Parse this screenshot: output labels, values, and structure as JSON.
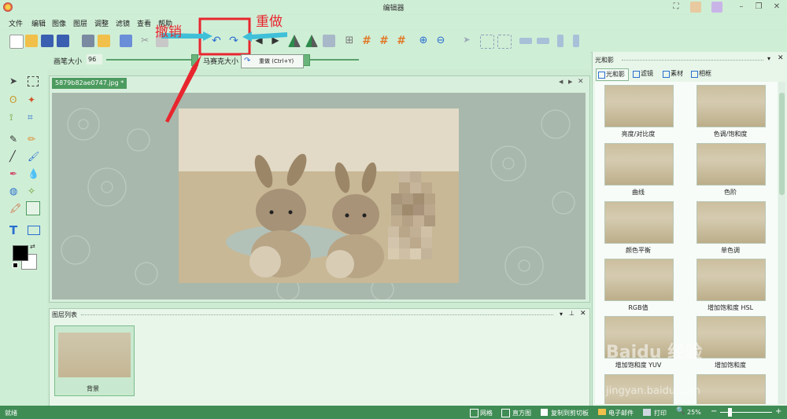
{
  "window": {
    "title": "编辑器"
  },
  "menu": {
    "items": [
      "文件",
      "编辑",
      "图像",
      "图层",
      "调整",
      "滤镜",
      "查看",
      "帮助"
    ]
  },
  "brush": {
    "size_label": "画笔大小",
    "size_value": "96",
    "mosaic_label": "马赛克大小"
  },
  "tooltip": {
    "text": "重做 (Ctrl+Y)"
  },
  "annotations": {
    "undo": "撤销",
    "redo": "重做"
  },
  "document": {
    "tab_title": "5879b82ae0747.jpg *"
  },
  "layers": {
    "title": "图层列表",
    "items": [
      "背景"
    ]
  },
  "right_panel": {
    "title": "光和影",
    "tabs": [
      "光和影",
      "滤镜",
      "素材",
      "相框"
    ],
    "effects": [
      "亮度/对比度",
      "色调/饱和度",
      "曲线",
      "色阶",
      "颜色平衡",
      "单色调",
      "RGB值",
      "增加饱和度 HSL",
      "增加饱和度 YUV",
      "增加饱和度"
    ]
  },
  "status": {
    "left": "就绪",
    "grid": "网格",
    "histogram": "直方图",
    "copy": "复制到剪切板",
    "email": "电子邮件",
    "print": "打印",
    "zoom": "25%"
  },
  "watermark": {
    "text": "Baidu 经验",
    "url": "jingyan.baidu.com"
  },
  "colors": {
    "accent": "#3f8c55",
    "annotation": "#e8262e",
    "panel_bg": "#cfeed6",
    "tab_active": "#4c9b5f"
  }
}
